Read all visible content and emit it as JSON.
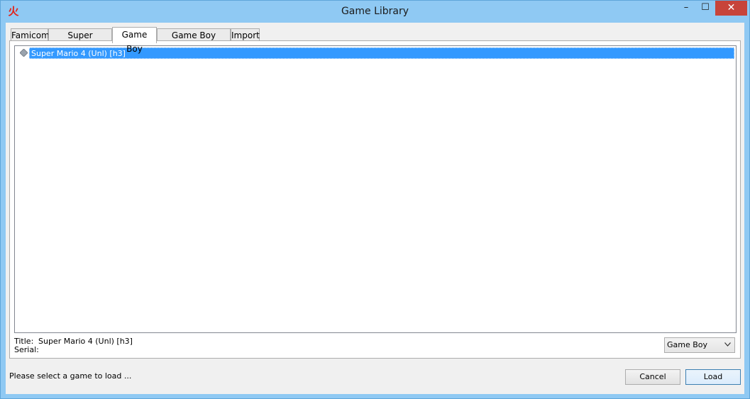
{
  "window": {
    "title": "Game Library",
    "app_icon": "火",
    "controls": {
      "minimize": "–",
      "maximize": "☐",
      "close": "✕"
    }
  },
  "tabs": [
    {
      "label": "Famicom"
    },
    {
      "label": "Super Famicom"
    },
    {
      "label": "Game Boy",
      "active": true
    },
    {
      "label": "Game Boy Advance"
    },
    {
      "label": "Import"
    }
  ],
  "list": {
    "items": [
      {
        "label": "Super Mario 4 (Unl) [h3]",
        "selected": true,
        "icon": "cartridge-icon"
      }
    ]
  },
  "info": {
    "title_label": "Title:",
    "title_value": "Super Mario 4 (Unl) [h3]",
    "serial_label": "Serial:",
    "serial_value": ""
  },
  "system_select": {
    "value": "Game Boy"
  },
  "status": {
    "text": "Please select a game to load ..."
  },
  "buttons": {
    "cancel": "Cancel",
    "load": "Load"
  },
  "colors": {
    "selection": "#3399ff",
    "close_button": "#c7443a",
    "titlebar": "#8fc9f3"
  }
}
